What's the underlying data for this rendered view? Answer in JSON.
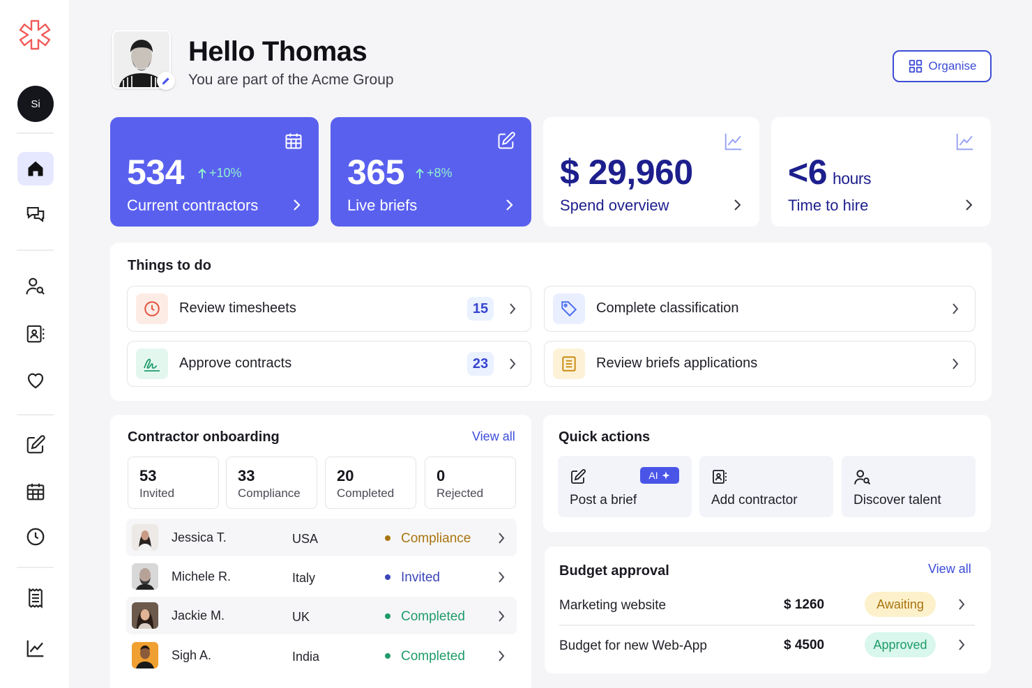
{
  "sidebar": {
    "avatar_initials": "Si",
    "items": [
      {
        "icon": "home-icon"
      },
      {
        "icon": "chat-icon"
      },
      {
        "icon": "user-search-icon"
      },
      {
        "icon": "contact-card-icon"
      },
      {
        "icon": "heart-icon"
      },
      {
        "icon": "edit-icon"
      },
      {
        "icon": "calendar-icon"
      },
      {
        "icon": "clock-icon"
      },
      {
        "icon": "receipt-icon"
      },
      {
        "icon": "chart-icon"
      }
    ]
  },
  "header": {
    "greeting": "Hello Thomas",
    "subtitle": "You are part of the Acme Group",
    "organise_label": "Organise"
  },
  "stats": [
    {
      "value": "534",
      "trend": "+10%",
      "label": "Current contractors",
      "icon": "calendar-icon"
    },
    {
      "value": "365",
      "trend": "+8%",
      "label": "Live briefs",
      "icon": "edit-icon"
    },
    {
      "value": "$ 29,960",
      "label": "Spend overview",
      "icon": "chart-icon"
    },
    {
      "value": "<6",
      "unit": "hours",
      "label": "Time to hire",
      "icon": "chart-icon"
    }
  ],
  "todo": {
    "title": "Things to do",
    "items": [
      {
        "label": "Review timesheets",
        "count": "15",
        "icon": "clock-icon"
      },
      {
        "label": "Complete classification",
        "icon": "tag-icon"
      },
      {
        "label": "Approve contracts",
        "count": "23",
        "icon": "signature-icon"
      },
      {
        "label": "Review briefs applications",
        "icon": "list-icon"
      }
    ]
  },
  "onboarding": {
    "title": "Contractor onboarding",
    "view_all": "View all",
    "summary": [
      {
        "count": "53",
        "label": "Invited"
      },
      {
        "count": "33",
        "label": "Compliance"
      },
      {
        "count": "20",
        "label": "Completed"
      },
      {
        "count": "0",
        "label": "Rejected"
      }
    ],
    "rows": [
      {
        "name": "Jessica T.",
        "country": "USA",
        "status": "Compliance"
      },
      {
        "name": "Michele R.",
        "country": "Italy",
        "status": "Invited"
      },
      {
        "name": "Jackie M.",
        "country": "UK",
        "status": "Completed"
      },
      {
        "name": "Sigh A.",
        "country": "India",
        "status": "Completed"
      }
    ]
  },
  "quick_actions": {
    "title": "Quick actions",
    "ai_badge": "AI",
    "items": [
      {
        "label": "Post a brief",
        "icon": "edit-icon"
      },
      {
        "label": "Add contractor",
        "icon": "add-contractor-icon"
      },
      {
        "label": "Discover talent",
        "icon": "user-search-icon"
      }
    ]
  },
  "budget": {
    "title": "Budget approval",
    "view_all": "View all",
    "rows": [
      {
        "name": "Marketing website",
        "amount": "$ 1260",
        "status": "Awaiting"
      },
      {
        "name": "Budget for new Web-App",
        "amount": "$ 4500",
        "status": "Approved"
      }
    ]
  },
  "colors": {
    "accent": "#5a60ee",
    "link": "#3c4cd7",
    "compliance": "#a8740f",
    "invited": "#3b45b8",
    "completed": "#1f9b6a",
    "awaiting_bg": "#fdf1cc",
    "approved_bg": "#d9f7ec"
  }
}
